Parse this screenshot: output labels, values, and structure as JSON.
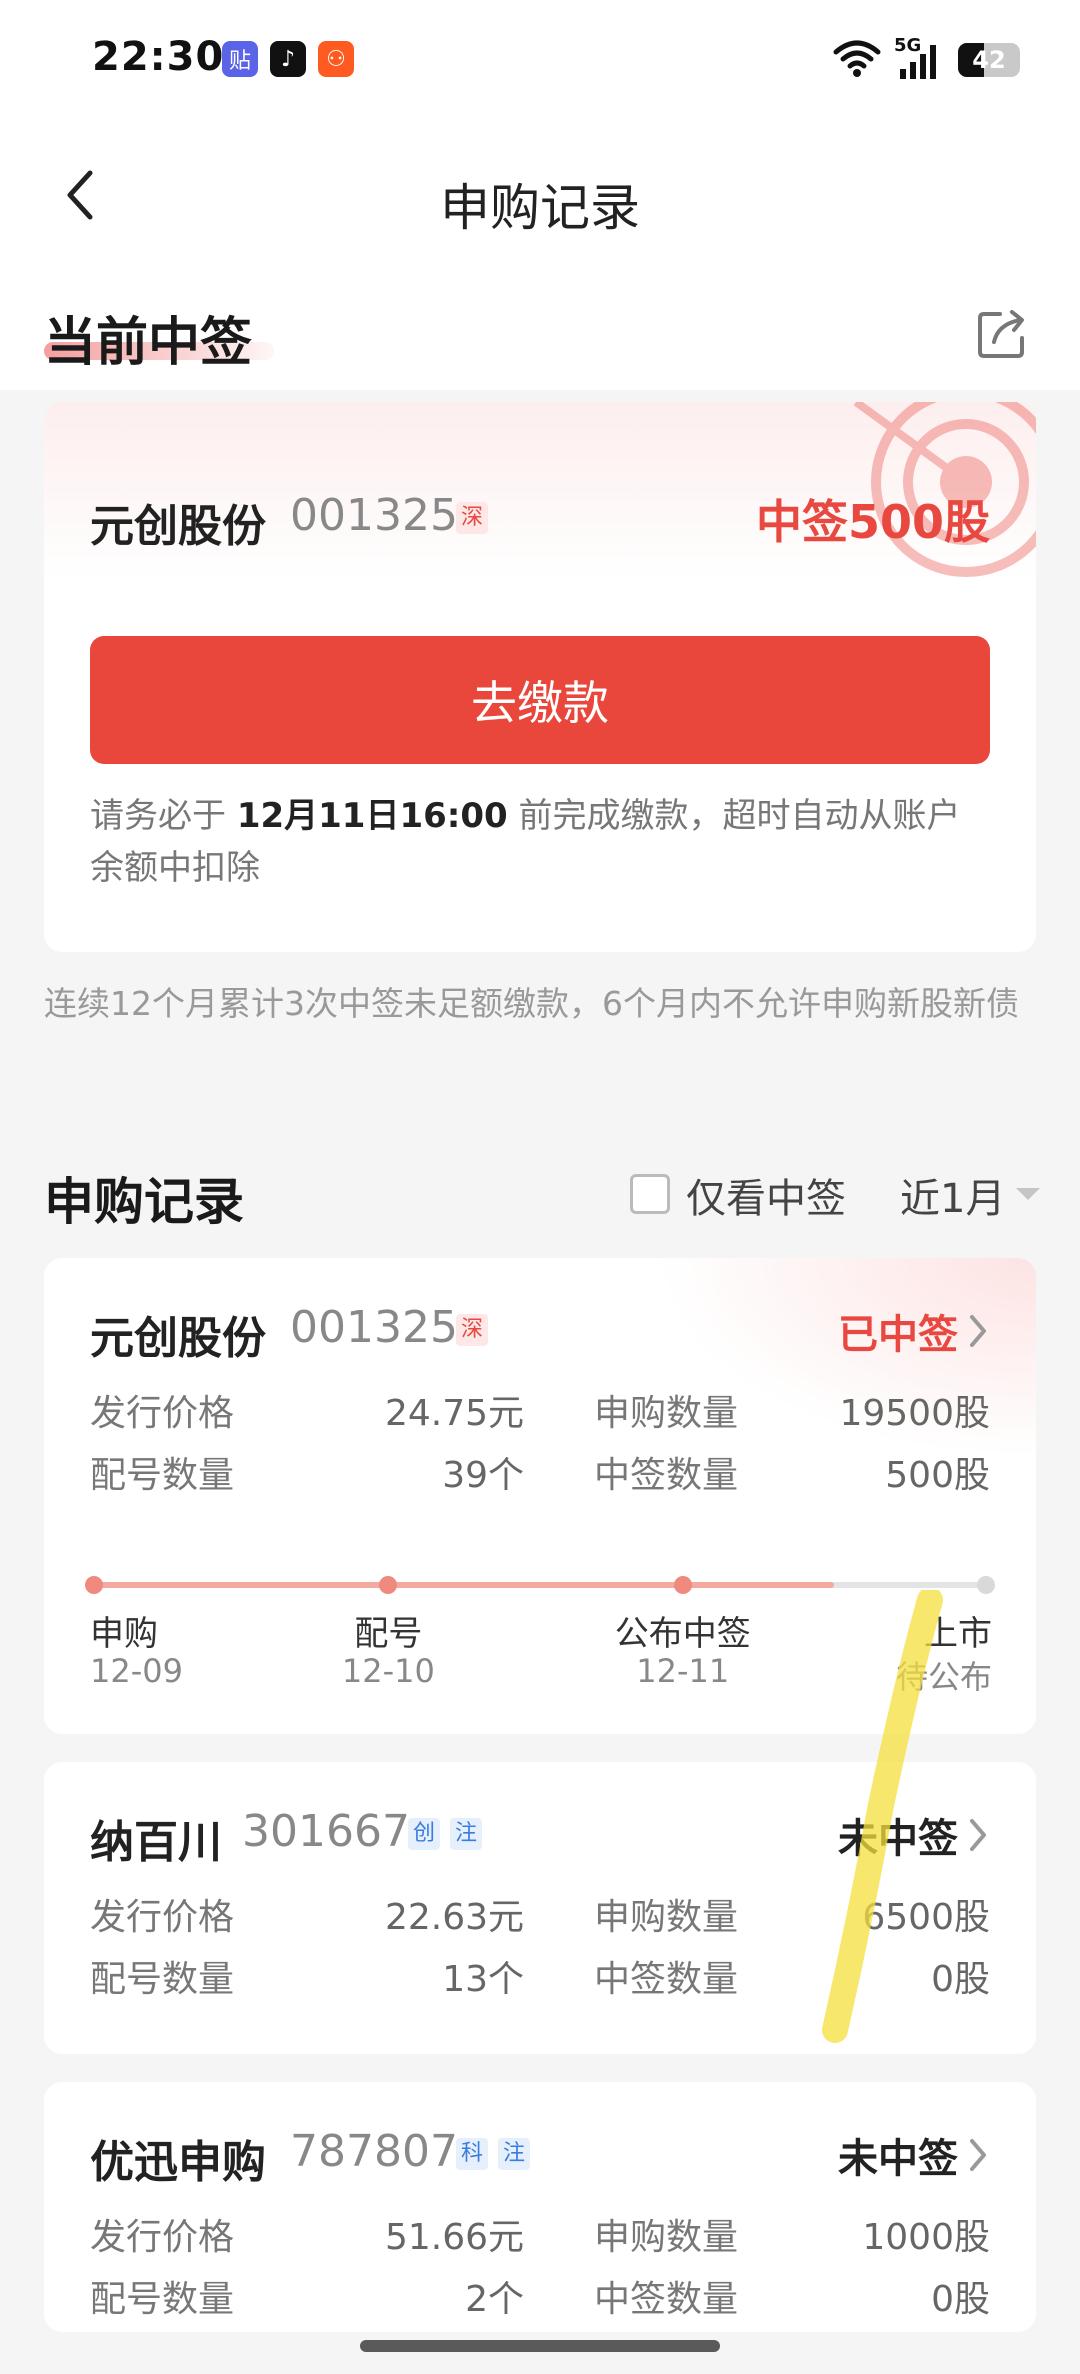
{
  "status_bar": {
    "time": "22:30",
    "network": "5G",
    "battery": "42",
    "battery_level": 0.42,
    "app_icons": [
      {
        "name": "tieba-app-icon",
        "color": "#5b63e8",
        "glyph": "贴"
      },
      {
        "name": "douyin-app-icon",
        "color": "#111111",
        "glyph": "♪"
      },
      {
        "name": "kuaishou-app-icon",
        "color": "#ff5a1f",
        "glyph": "⚇"
      }
    ]
  },
  "header": {
    "title": "申购记录"
  },
  "current": {
    "title": "当前中签",
    "stock_name": "元创股份",
    "stock_code": "001325",
    "market_tag": "深",
    "hit_amount": "中签500股",
    "pay_button": "去缴款",
    "note_prefix": "请务必于 ",
    "note_deadline": "12月11日16:00",
    "note_suffix": " 前完成缴款，超时自动从账户余额中扣除"
  },
  "warning": "连续12个月累计3次中签未足额缴款，6个月内不允许申购新股新债",
  "records": {
    "title": "申购记录",
    "filter_label": "仅看中签",
    "period": "近1月",
    "items": [
      {
        "name": "元创股份",
        "code": "001325",
        "tags": [
          "深"
        ],
        "status": "已中签",
        "status_color": "#e8483f",
        "issue_price_label": "发行价格",
        "issue_price": "24.75元",
        "subscribe_qty_label": "申购数量",
        "subscribe_qty": "19500股",
        "match_qty_label": "配号数量",
        "match_qty": "39个",
        "won_qty_label": "中签数量",
        "won_qty": "500股",
        "progress": {
          "completed_fraction": 0.83,
          "steps": [
            {
              "label": "申购",
              "date": "12-09",
              "done": true
            },
            {
              "label": "配号",
              "date": "12-10",
              "done": true
            },
            {
              "label": "公布中签",
              "date": "12-11",
              "done": true
            },
            {
              "label": "上市",
              "date": "待公布",
              "done": false
            }
          ]
        }
      },
      {
        "name": "纳百川",
        "code": "301667",
        "tags": [
          "创",
          "注"
        ],
        "status": "未中签",
        "status_color": "#222222",
        "issue_price_label": "发行价格",
        "issue_price": "22.63元",
        "subscribe_qty_label": "申购数量",
        "subscribe_qty": "6500股",
        "match_qty_label": "配号数量",
        "match_qty": "13个",
        "won_qty_label": "中签数量",
        "won_qty": "0股"
      },
      {
        "name": "优迅申购",
        "code": "787807",
        "tags": [
          "科",
          "注"
        ],
        "status": "未中签",
        "status_color": "#222222",
        "issue_price_label": "发行价格",
        "issue_price": "51.66元",
        "subscribe_qty_label": "申购数量",
        "subscribe_qty": "1000股",
        "match_qty_label": "配号数量",
        "match_qty": "2个",
        "won_qty_label": "中签数量",
        "won_qty": "0股"
      }
    ]
  }
}
